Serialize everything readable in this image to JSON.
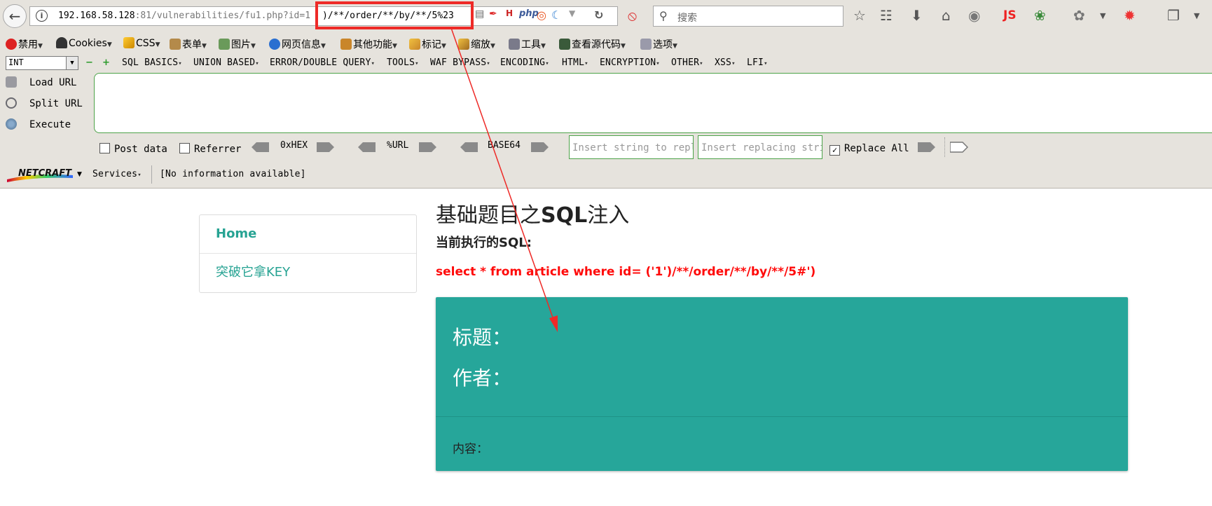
{
  "browser": {
    "url_prefix": "192.168.58.128",
    "url_rest": ":81/vulnerabilities/fu1.php?id=1",
    "url_highlight": ")/**/order/**/by/**/5%23",
    "search_placeholder": "搜索",
    "addons": [
      "php",
      "JS"
    ]
  },
  "menubar": {
    "items": [
      "禁用",
      "Cookies",
      "CSS",
      "表单",
      "图片",
      "网页信息",
      "其他功能",
      "标记",
      "缩放",
      "工具",
      "查看源代码",
      "选项"
    ]
  },
  "hackbar": {
    "type_select": "INT",
    "menus": [
      "SQL BASICS",
      "UNION BASED",
      "ERROR/DOUBLE QUERY",
      "TOOLS",
      "WAF BYPASS",
      "ENCODING",
      "HTML",
      "ENCRYPTION",
      "OTHER",
      "XSS",
      "LFI"
    ],
    "load_url": "Load URL",
    "split_url": "Split URL",
    "execute": "Execute",
    "post_data": "Post data",
    "referrer": "Referrer",
    "hex": "0xHEX",
    "urlenc": "%URL",
    "base64": "BASE64",
    "insert_string_placeholder": "Insert string to replace",
    "insert_replacing_placeholder": "Insert replacing string",
    "replace_all": "Replace All"
  },
  "netcraft": {
    "logo": "NETCRAFT",
    "services": "Services",
    "info": "[No information available]"
  },
  "page": {
    "nav": [
      "Home",
      "突破它拿KEY"
    ],
    "title_prefix": "基础题目之",
    "title_bold": "SQL",
    "title_suffix": "注入",
    "sql_label_prefix": "当前执行的",
    "sql_label_suffix": "SQL:",
    "sql_query": "select * from article where id= ('1')/**/order/**/by/**/5#')",
    "card_title": "标题：",
    "card_author": "作者：",
    "card_content": "内容："
  },
  "colors": {
    "highlight_box": "#ee2a27",
    "teal_panel": "#26a69a",
    "link": "#27a393",
    "sql_red": "#ff0a0a"
  }
}
